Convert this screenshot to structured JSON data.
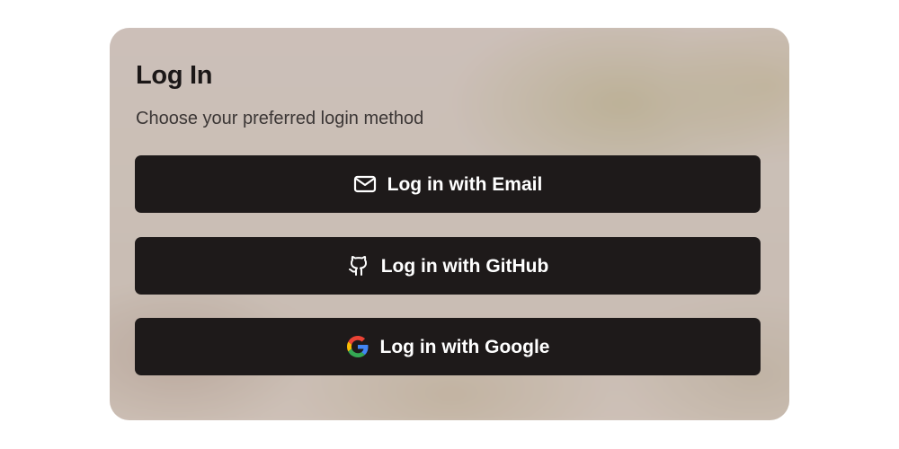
{
  "login": {
    "title": "Log In",
    "subtitle": "Choose your preferred login method",
    "buttons": [
      {
        "label": "Log in with Email",
        "icon": "mail-icon"
      },
      {
        "label": "Log in with GitHub",
        "icon": "github-icon"
      },
      {
        "label": "Log in with Google",
        "icon": "google-icon"
      }
    ]
  },
  "colors": {
    "button_bg": "#1e1a1a",
    "button_text": "#ffffff",
    "title_text": "#1b1717",
    "subtitle_text": "#3b3635",
    "page_bg": "#ffffff",
    "google_blue": "#4285F4",
    "google_red": "#EA4335",
    "google_yellow": "#FBBC05",
    "google_green": "#34A853"
  }
}
